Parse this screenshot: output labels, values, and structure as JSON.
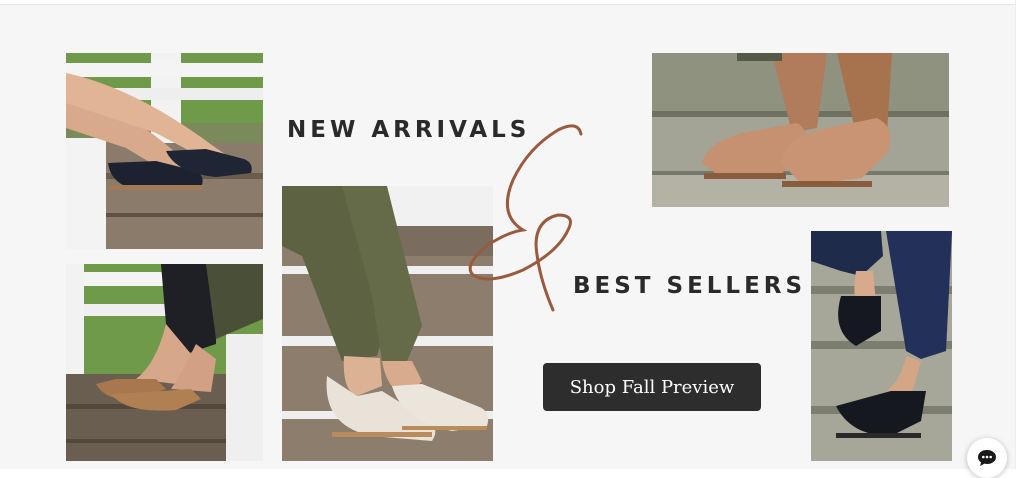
{
  "hero": {
    "headline_1": "NEW ARRIVALS",
    "ampersand": "&",
    "headline_2": "BEST SELLERS",
    "cta_label": "Shop Fall Preview"
  },
  "chat": {
    "icon": "chat-bubble-icon"
  },
  "colors": {
    "background": "#f6f6f6",
    "headline": "#2a2a2a",
    "ampersand": "#9a5a3e",
    "cta_background": "#2d2d2d",
    "cta_text": "#ffffff"
  },
  "photos": [
    {
      "name": "black-flats-on-porch-steps"
    },
    {
      "name": "tan-flats-on-porch-steps"
    },
    {
      "name": "cream-slip-on-on-steps"
    },
    {
      "name": "tan-loafers-on-stone-steps"
    },
    {
      "name": "black-slip-on-on-stone-steps"
    }
  ]
}
